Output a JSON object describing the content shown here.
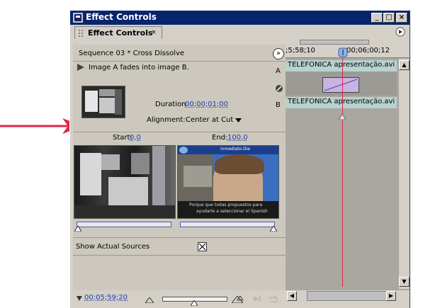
{
  "window": {
    "title": "Effect Controls",
    "minimize_label": "_",
    "maximize_label": "□",
    "close_label": "×"
  },
  "tab": {
    "label": "Effect Controls",
    "close_label": "×"
  },
  "header": {
    "sequence_label": "Sequence 03 * Cross Dissolve",
    "nav_button": "»",
    "ruler_left": ";5;58;10",
    "ruler_right": "00;06;00;12"
  },
  "transition": {
    "description": "Image A fades into image B.",
    "duration_label": "Duration",
    "duration_value": "00;00;01;00",
    "alignment_label": "Alignment:",
    "alignment_value": "Center at Cut",
    "a_label": "A",
    "b_label": "B"
  },
  "preview": {
    "start_label": "Start:",
    "start_value": "0,0",
    "end_label": "End:",
    "end_value": "100,0",
    "start_fraction": 0.0,
    "end_fraction": 1.0,
    "b_overlay_text": "inmediato.Dia",
    "b_caption_line1": "Porque que todas propuestos para",
    "b_caption_line2": "ayudarle a seleccionar el Spanish"
  },
  "options": {
    "show_actual_sources_label": "Show Actual Sources",
    "show_actual_sources_checked": true
  },
  "timeline": {
    "clip_a_label": "TELEFONICA apresentação.avi",
    "clip_b_label": "TELEFONICA apresentação.avi"
  },
  "footer": {
    "timecode": "00;05;59;20"
  },
  "colors": {
    "title_bar": "#08246b",
    "arrow": "#e0264a",
    "clip": "#b7d2cf",
    "transition": "#c9b3e0",
    "link_blue": "#1f3ea8"
  }
}
